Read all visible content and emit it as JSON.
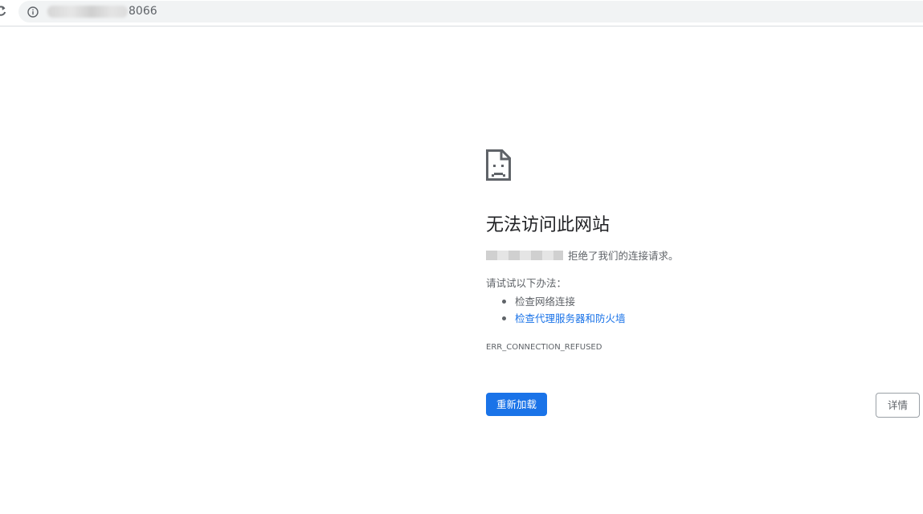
{
  "address_bar": {
    "url_visible_suffix": "8066"
  },
  "icons": {
    "reload": "reload-icon",
    "site_info": "info-icon",
    "error": "sad-file-icon"
  },
  "error_page": {
    "title": "无法访问此网站",
    "refused_text": "拒绝了我们的连接请求。",
    "suggestions_intro": "请试试以下办法：",
    "suggestions": [
      {
        "label": "检查网络连接",
        "is_link": false
      },
      {
        "label": "检查代理服务器和防火墙",
        "is_link": true
      }
    ],
    "error_code": "ERR_CONNECTION_REFUSED",
    "reload_label": "重新加载",
    "details_label": "详情"
  },
  "colors": {
    "primary_button": "#1a73e8",
    "link": "#1a73e8",
    "secondary_text": "#5f6368",
    "title_text": "#202124"
  }
}
